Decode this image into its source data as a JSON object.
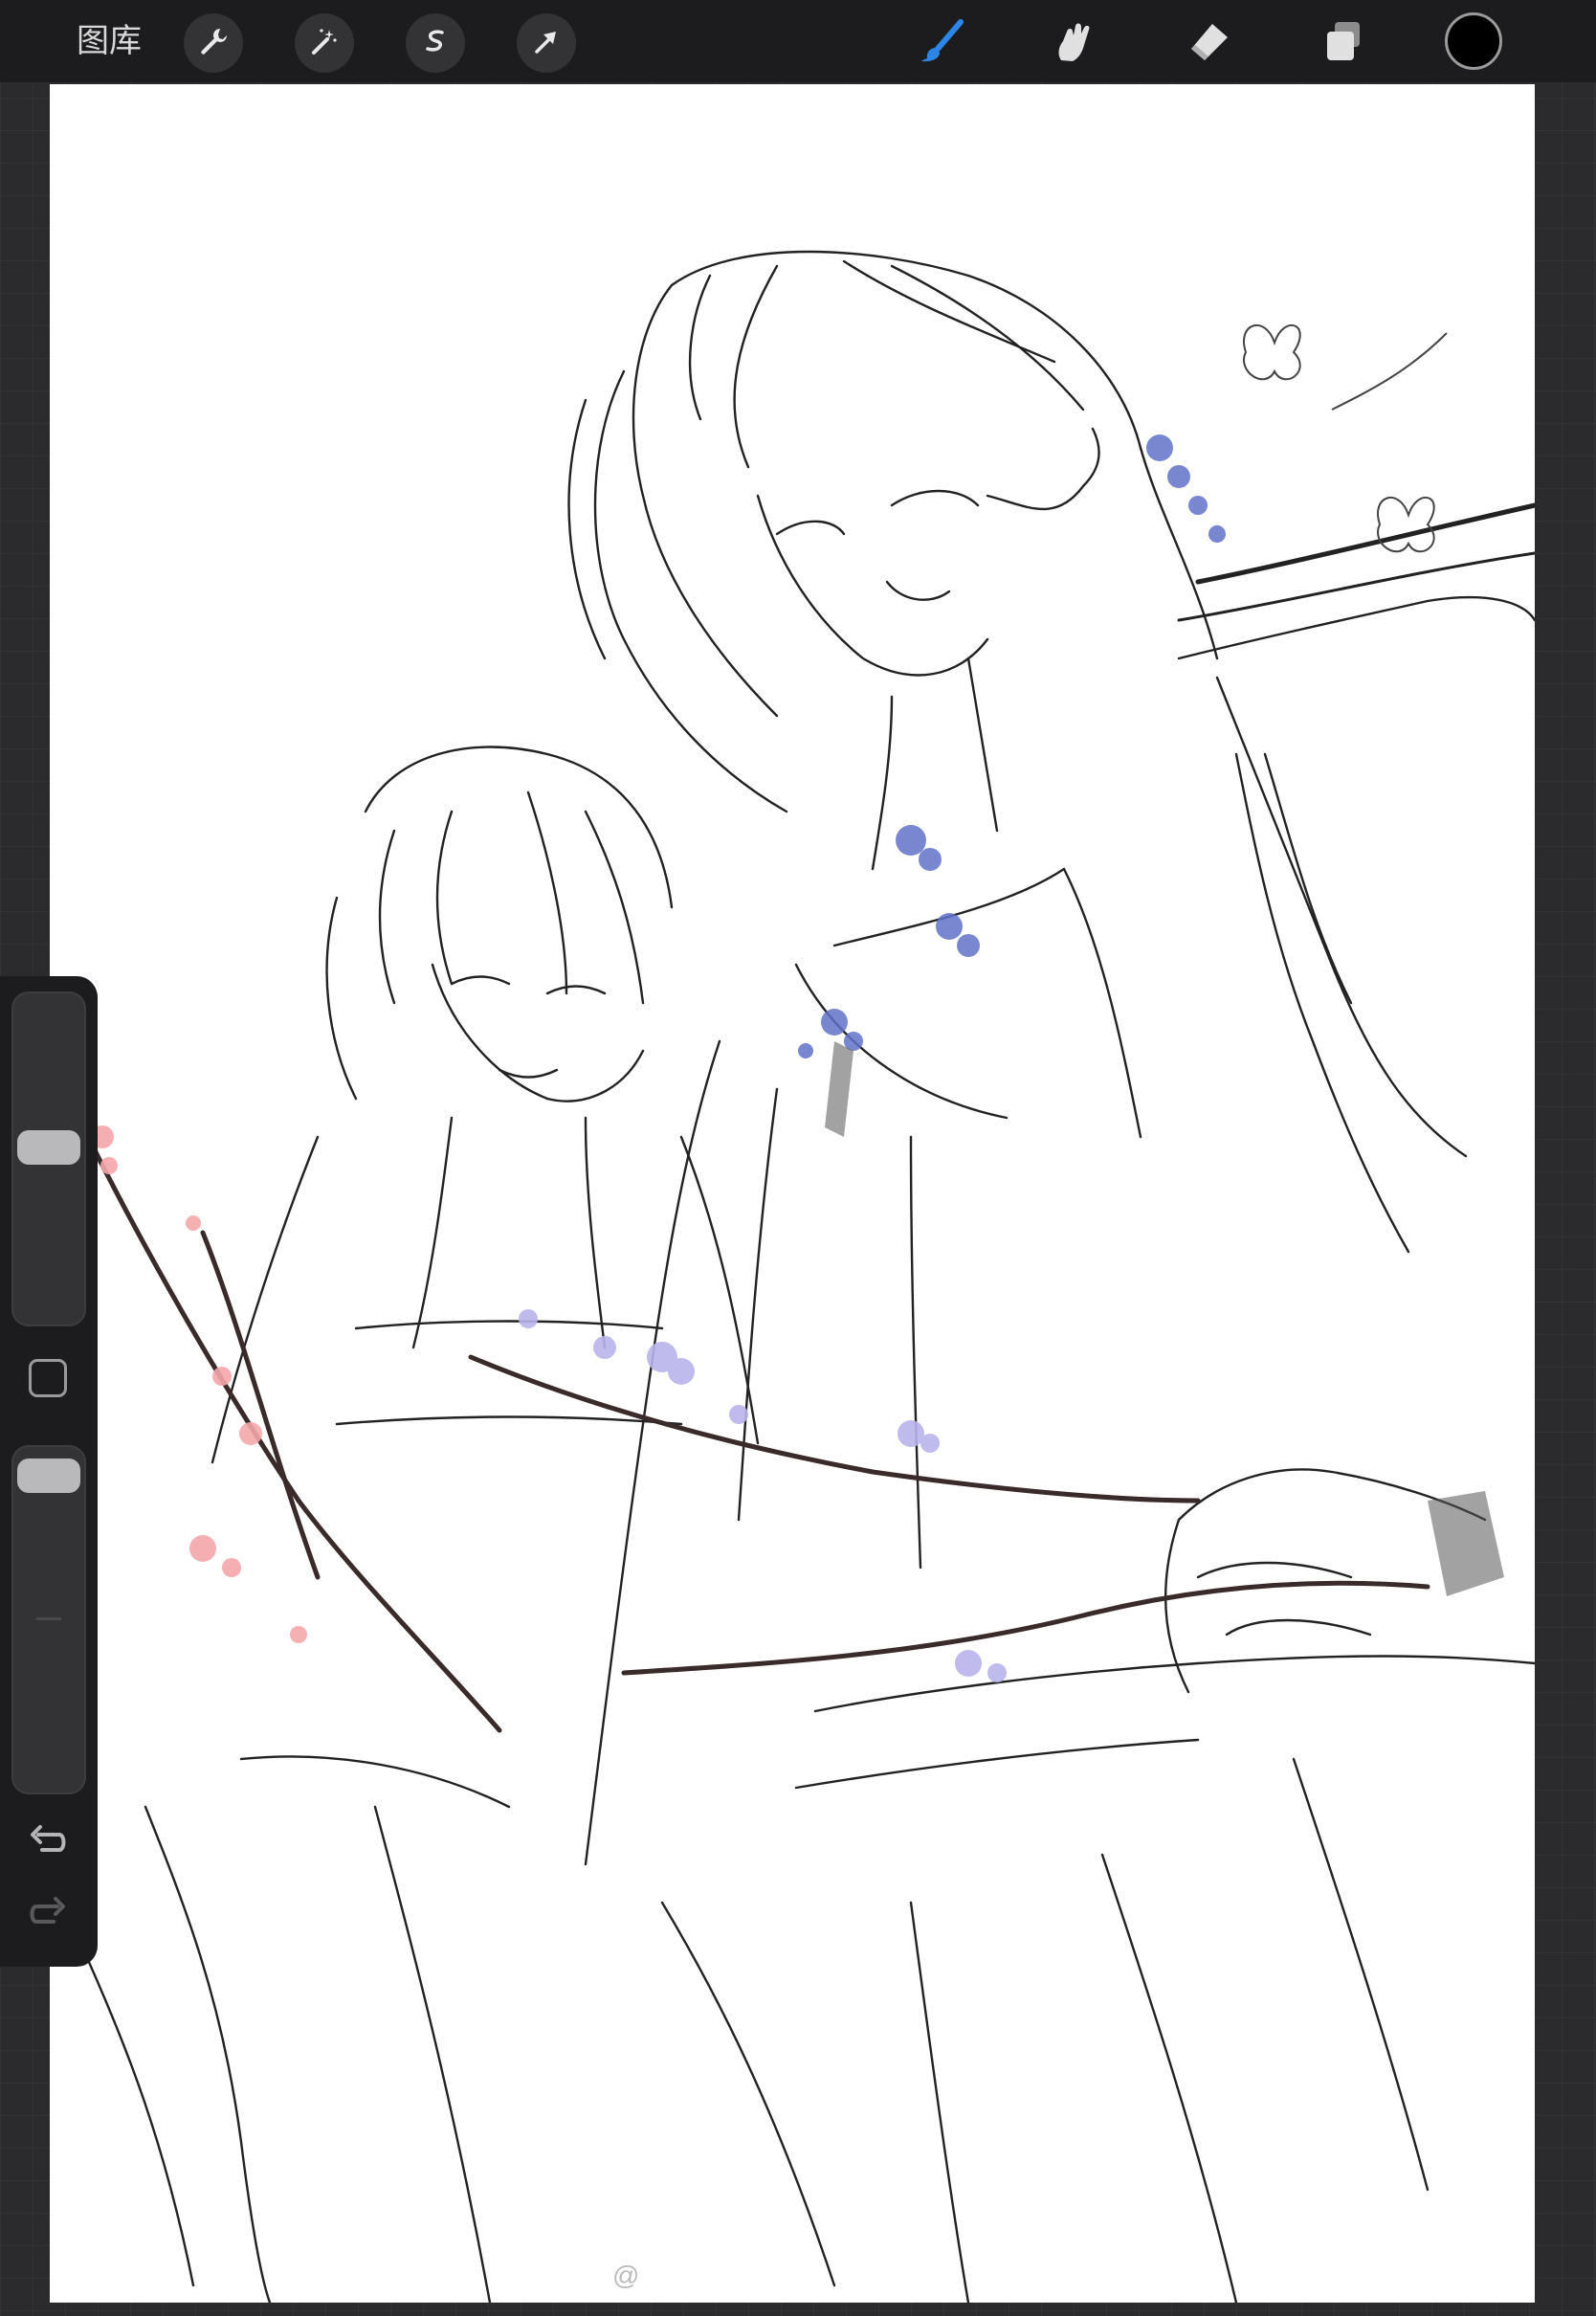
{
  "app": {
    "gallery_label": "图库"
  },
  "toolbar": {
    "left_tools": [
      "wrench-icon",
      "magic-wand-icon",
      "selection-s-icon",
      "transform-arrow-icon"
    ],
    "right_tools": [
      "brush-icon",
      "smudge-icon",
      "eraser-icon",
      "layers-icon"
    ],
    "active_tool": "brush",
    "active_color": "#000000",
    "accent_color": "#2b86e8"
  },
  "sidebar": {
    "brush_size_level": 0.55,
    "opacity_level": 0.95
  },
  "canvas": {
    "background": "#ffffff"
  },
  "watermark": {
    "text": "@"
  }
}
